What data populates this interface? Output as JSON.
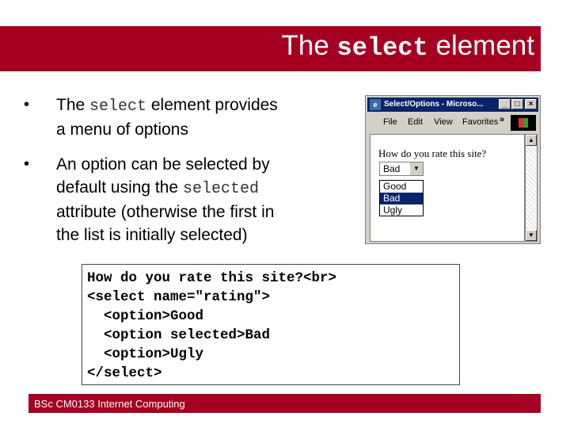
{
  "slide": {
    "title_prefix": "The ",
    "title_code": "select",
    "title_suffix": " element",
    "bullets": [
      {
        "line1_a": "The ",
        "line1_code": "select",
        "line1_b": " element provides",
        "line2": "a menu of options"
      },
      {
        "line1": "An option can be selected by",
        "line2_a": "default using the ",
        "line2_code": "selected",
        "line3": "attribute (otherwise the first in",
        "line4": "the list is initially selected)"
      }
    ],
    "code_lines": [
      "How do you rate this site?<br>",
      "<select name=\"rating\">",
      "  <option>Good",
      "  <option selected>Bad",
      "  <option>Ugly",
      "</select>"
    ],
    "footer": "BSc CM0133 Internet Computing"
  },
  "browser": {
    "title": "Select/Options - Microso...",
    "buttons": {
      "minimize": "_",
      "maximize": "□",
      "close": "×"
    },
    "menu": [
      "File",
      "Edit",
      "View",
      "Favorites"
    ],
    "chevron": "»",
    "prompt": "How do you rate this site?",
    "select_value": "Bad",
    "options": [
      "Good",
      "Bad",
      "Ugly"
    ],
    "highlighted_option": "Bad",
    "colors": {
      "accent": "#a50021",
      "titlebar": "#0a246a"
    }
  }
}
